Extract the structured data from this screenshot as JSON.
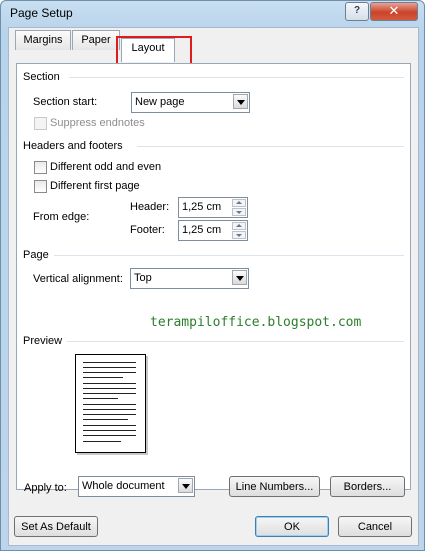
{
  "window": {
    "title": "Page Setup",
    "help_glyph": "?",
    "close_glyph": "✕"
  },
  "tabs": [
    {
      "label": "Margins"
    },
    {
      "label": "Paper"
    },
    {
      "label": "Layout"
    }
  ],
  "section": {
    "heading": "Section",
    "start_label": "Section start:",
    "start_value": "New page",
    "suppress_endnotes": "Suppress endnotes"
  },
  "headers_footers": {
    "heading": "Headers and footers",
    "different_odd_even": "Different odd and even",
    "different_first_page": "Different first page",
    "from_edge_label": "From edge:",
    "header_label": "Header:",
    "header_value": "1,25 cm",
    "footer_label": "Footer:",
    "footer_value": "1,25 cm"
  },
  "page": {
    "heading": "Page",
    "vertical_alignment_label": "Vertical alignment:",
    "vertical_alignment_value": "Top"
  },
  "watermark": "terampiloffice.blogspot.com",
  "preview": {
    "heading": "Preview"
  },
  "apply": {
    "label": "Apply to:",
    "value": "Whole document",
    "line_numbers": "Line Numbers...",
    "borders": "Borders..."
  },
  "footer": {
    "set_default": "Set As Default",
    "ok": "OK",
    "cancel": "Cancel"
  },
  "colors": {
    "highlight": "#e01b1b",
    "watermark": "#2a7f2a"
  }
}
